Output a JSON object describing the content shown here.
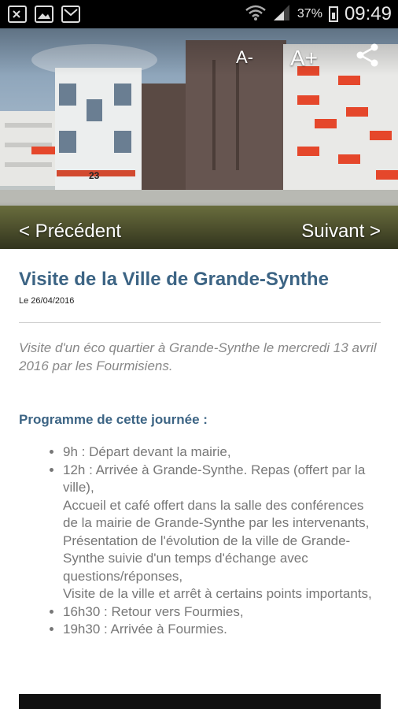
{
  "status_bar": {
    "battery_percent": "37%",
    "time": "09:49",
    "icons": [
      "document-x-icon",
      "image-icon",
      "gmail-icon",
      "wifi-icon",
      "signal-icon",
      "battery-icon"
    ]
  },
  "hero": {
    "font_decrease_label": "A-",
    "font_increase_label": "A+",
    "prev_label": "< Précédent",
    "next_label": "Suivant >",
    "building_number": "23"
  },
  "article": {
    "title": "Visite de la Ville de Grande-Synthe",
    "date": "Le 26/04/2016",
    "intro": "Visite d'un éco quartier à Grande-Synthe le mercredi 13 avril 2016 par les Fourmisiens.",
    "programme_title": "Programme de cette journée :",
    "programme_items": [
      "9h : Départ devant la mairie,",
      "12h : Arrivée à Grande-Synthe. Repas (offert par la ville),\nAccueil et café offert dans la salle des conférences de la mairie de Grande-Synthe par les intervenants,\nPrésentation de l'évolution de la ville de Grande-Synthe suivie d'un temps d'échange avec questions/réponses,\nVisite de la ville et arrêt à certains points importants,",
      "16h30 : Retour vers Fourmies,",
      "19h30 : Arrivée à Fourmies."
    ]
  },
  "colors": {
    "accent": "#3c6484",
    "body_text": "#777777",
    "intro_text": "#888888",
    "balcony": "#e5472b"
  }
}
